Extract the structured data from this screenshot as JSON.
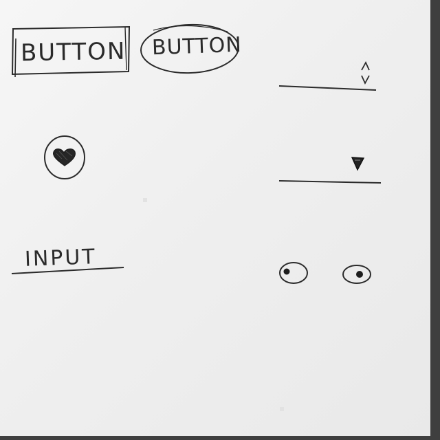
{
  "sketch": {
    "rect_button_label": "BUTTON",
    "oval_button_label": "BUTTON",
    "input_label": "INPUT",
    "icons": {
      "heart": "heart-icon",
      "stepper": "up-down-chevron-icon",
      "dropdown": "triangle-down-icon"
    }
  }
}
